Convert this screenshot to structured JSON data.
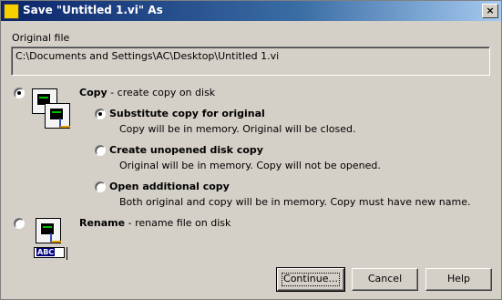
{
  "window": {
    "title": "Save \"Untitled 1.vi\" As",
    "close_label": "×"
  },
  "original_file": {
    "label": "Original file",
    "path": "C:\\Documents and Settings\\AC\\Desktop\\Untitled 1.vi"
  },
  "options": {
    "copy": {
      "label": "Copy",
      "description": " - create copy on disk",
      "selected": true
    },
    "sub_options": [
      {
        "label": "Substitute copy for original",
        "description": "Copy will be in memory. Original will be closed.",
        "selected": true
      },
      {
        "label": "Create unopened disk copy",
        "description": "Original will be in memory. Copy will not be opened.",
        "selected": false
      },
      {
        "label": "Open additional copy",
        "description": "Both original and copy will be in memory. Copy must have new name.",
        "selected": false
      }
    ],
    "rename": {
      "label": "Rename",
      "description": " - rename file on disk",
      "selected": false,
      "icon_text": "ABC"
    }
  },
  "buttons": {
    "continue": "Continue...",
    "cancel": "Cancel",
    "help": "Help"
  },
  "icons": {
    "title_icon": "labview-vi-icon",
    "copy_icon": "vi-copy-icon",
    "rename_icon": "vi-rename-icon"
  }
}
